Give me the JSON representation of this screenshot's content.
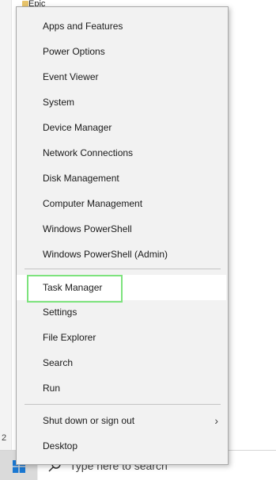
{
  "background": {
    "folder_label": "Epic",
    "count_text": "2"
  },
  "menu": {
    "items": [
      {
        "label": "Apps and Features"
      },
      {
        "label": "Power Options"
      },
      {
        "label": "Event Viewer"
      },
      {
        "label": "System"
      },
      {
        "label": "Device Manager"
      },
      {
        "label": "Network Connections"
      },
      {
        "label": "Disk Management"
      },
      {
        "label": "Computer Management"
      },
      {
        "label": "Windows PowerShell"
      },
      {
        "label": "Windows PowerShell (Admin)"
      },
      {
        "label": "Task Manager"
      },
      {
        "label": "Settings"
      },
      {
        "label": "File Explorer"
      },
      {
        "label": "Search"
      },
      {
        "label": "Run"
      },
      {
        "label": "Shut down or sign out",
        "submenu_icon": "chevron-right-icon"
      },
      {
        "label": "Desktop"
      }
    ],
    "highlighted_item": "Task Manager",
    "highlight_color": "#7de37d"
  },
  "taskbar": {
    "search_placeholder": "Type here to search",
    "start_icon": "windows-logo-icon",
    "search_icon": "search-icon"
  }
}
